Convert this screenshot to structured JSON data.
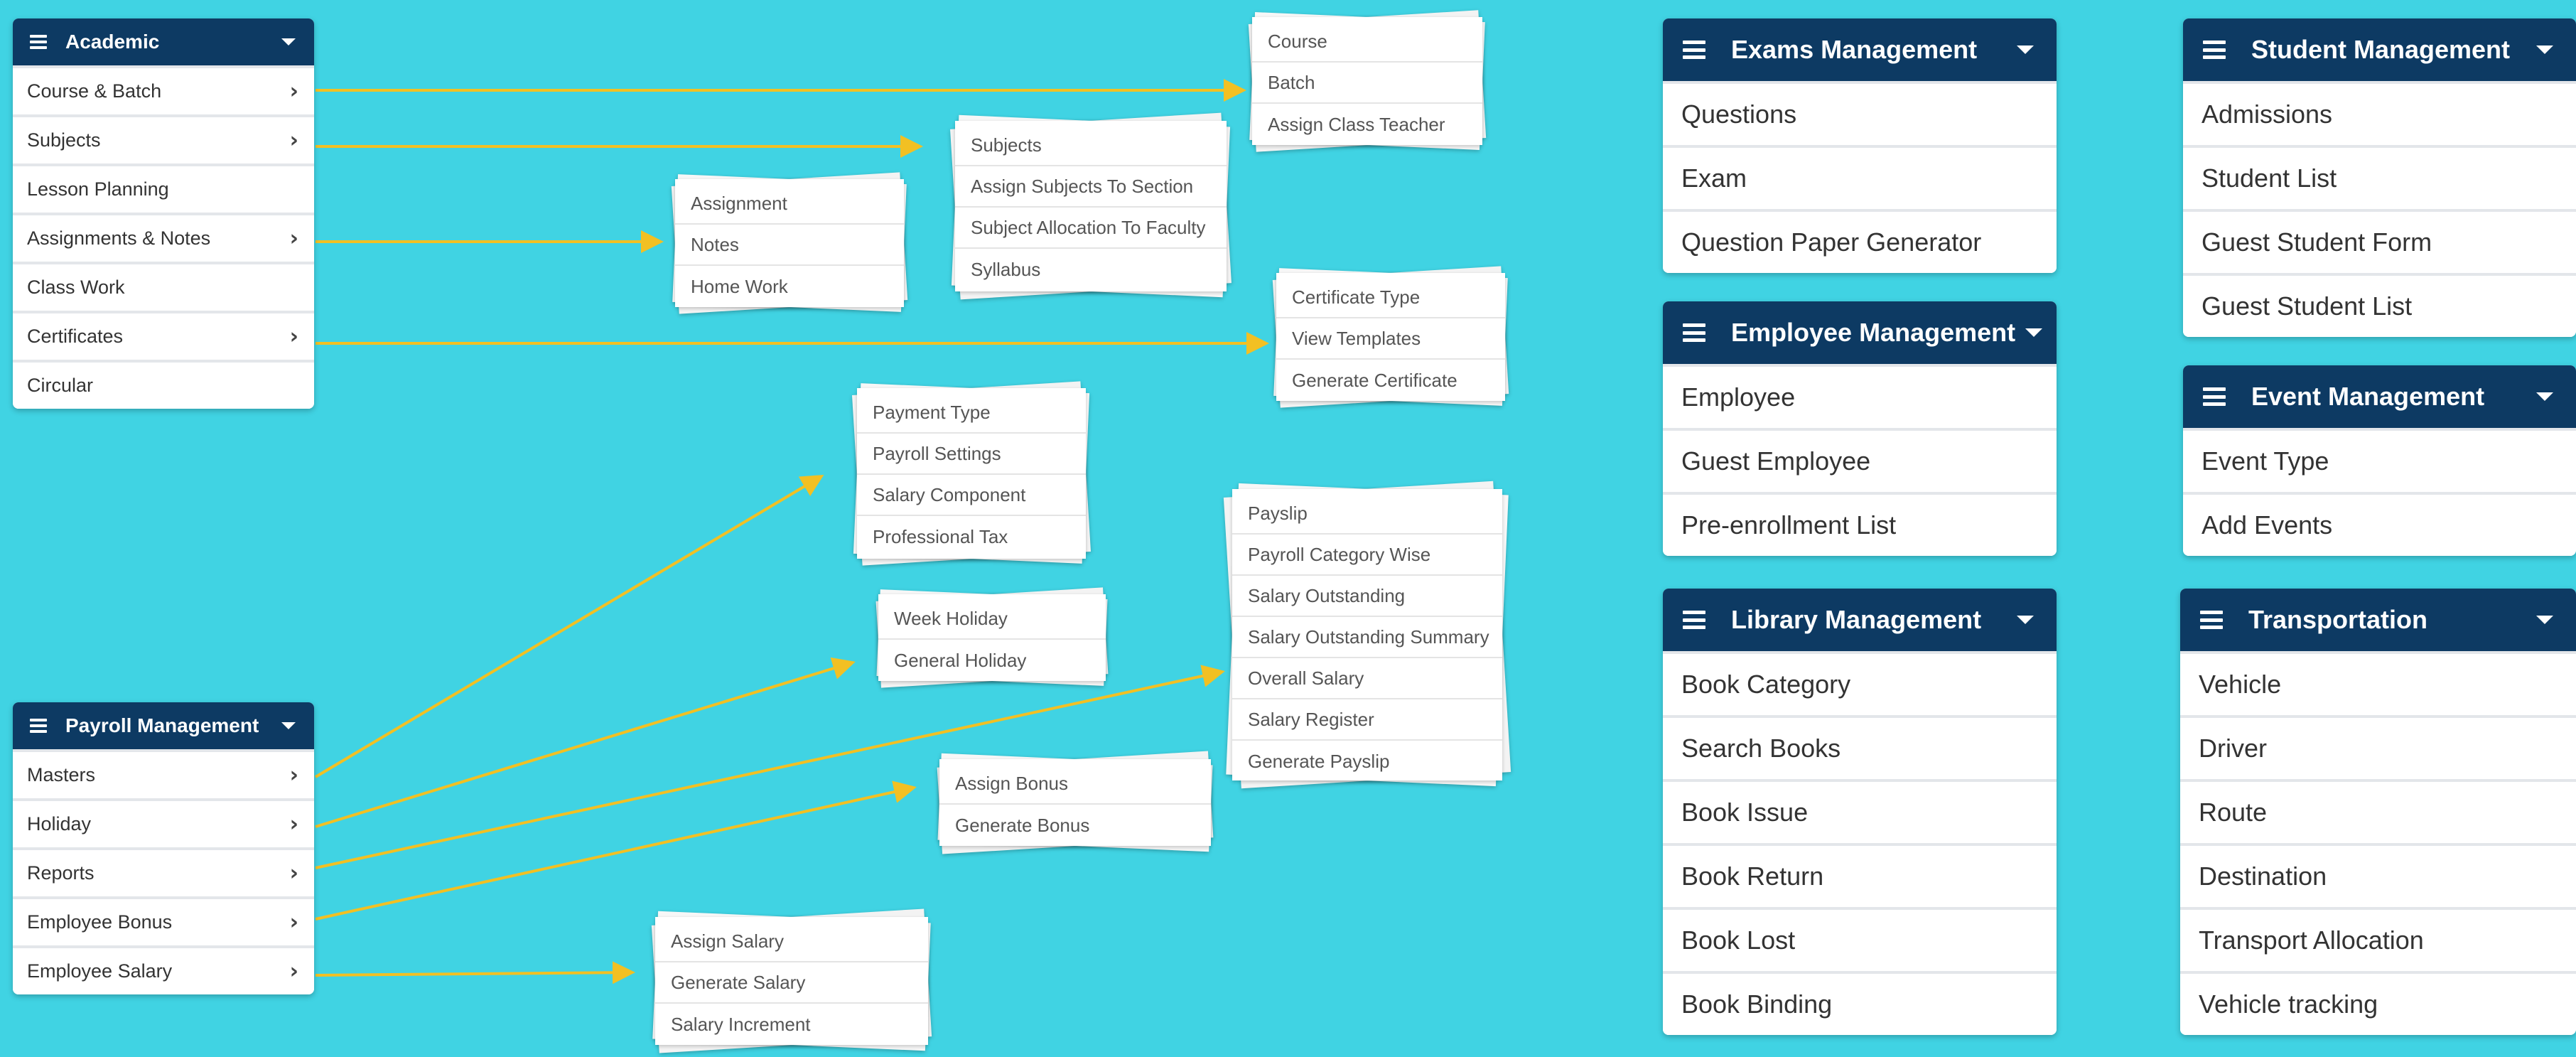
{
  "academic": {
    "title": "Academic",
    "items": [
      {
        "label": "Course & Batch",
        "chevron": true
      },
      {
        "label": "Subjects",
        "chevron": true
      },
      {
        "label": "Lesson Planning",
        "chevron": false
      },
      {
        "label": "Assignments & Notes",
        "chevron": true
      },
      {
        "label": "Class Work",
        "chevron": false
      },
      {
        "label": "Certificates",
        "chevron": true
      },
      {
        "label": "Circular",
        "chevron": false
      }
    ]
  },
  "payroll": {
    "title": "Payroll Management",
    "items": [
      {
        "label": "Masters",
        "chevron": true
      },
      {
        "label": "Holiday",
        "chevron": true
      },
      {
        "label": "Reports",
        "chevron": true
      },
      {
        "label": "Employee Bonus",
        "chevron": true
      },
      {
        "label": "Employee Salary",
        "chevron": true
      }
    ]
  },
  "submenus": {
    "course_batch": [
      "Course",
      "Batch",
      "Assign Class Teacher"
    ],
    "subjects": [
      "Subjects",
      "Assign Subjects To Section",
      "Subject Allocation To Faculty",
      "Syllabus"
    ],
    "assignments": [
      "Assignment",
      "Notes",
      "Home Work"
    ],
    "certificates": [
      "Certificate Type",
      "View Templates",
      "Generate Certificate"
    ],
    "masters": [
      "Payment Type",
      "Payroll Settings",
      "Salary Component",
      "Professional Tax"
    ],
    "holiday": [
      "Week Holiday",
      "General Holiday"
    ],
    "reports": [
      "Payslip",
      "Payroll Category Wise",
      "Salary Outstanding",
      "Salary Outstanding Summary",
      "Overall Salary",
      "Salary Register",
      "Generate Payslip"
    ],
    "bonus": [
      "Assign Bonus",
      "Generate Bonus"
    ],
    "salary": [
      "Assign Salary",
      "Generate Salary",
      "Salary Increment"
    ]
  },
  "exams": {
    "title": "Exams Management",
    "items": [
      "Questions",
      "Exam",
      "Question Paper Generator"
    ]
  },
  "employee": {
    "title": "Employee Management",
    "items": [
      "Employee",
      "Guest Employee",
      "Pre-enrollment List"
    ]
  },
  "library": {
    "title": "Library Management",
    "items": [
      "Book Category",
      "Search Books",
      "Book Issue",
      "Book Return",
      "Book Lost",
      "Book Binding"
    ]
  },
  "student": {
    "title": "Student Management",
    "items": [
      "Admissions",
      "Student List",
      "Guest Student Form",
      "Guest Student List"
    ]
  },
  "event": {
    "title": "Event Management",
    "items": [
      "Event Type",
      "Add Events"
    ]
  },
  "transport": {
    "title": "Transportation",
    "items": [
      "Vehicle",
      "Driver",
      "Route",
      "Destination",
      "Transport Allocation",
      "Vehicle tracking"
    ]
  },
  "colors": {
    "background": "#40d3e3",
    "header": "#0d3a63",
    "arrow": "#f2c023"
  },
  "icons": {
    "header": "hamburger-menu-icon",
    "dropdown": "caret-down-icon",
    "submenu": "chevron-right-icon"
  }
}
